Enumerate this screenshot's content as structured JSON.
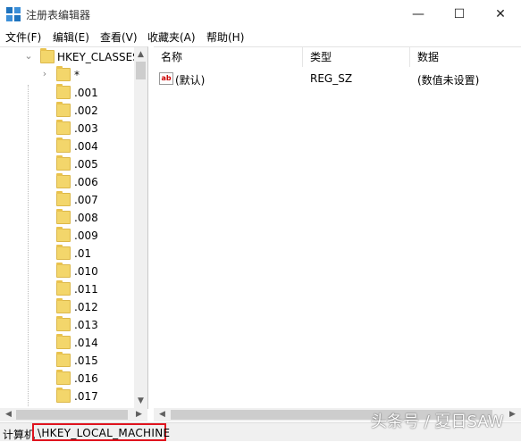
{
  "window": {
    "title": "注册表编辑器",
    "minimize": "—",
    "maximize": "☐",
    "close": "✕"
  },
  "menu": {
    "items": [
      "文件(F)",
      "编辑(E)",
      "查看(V)",
      "收藏夹(A)",
      "帮助(H)"
    ]
  },
  "tree": {
    "root_label": "HKEY_CLASSES",
    "root_chevron": "expanded",
    "items": [
      ".001",
      ".002",
      ".003",
      ".004",
      ".005",
      ".006",
      ".007",
      ".008",
      ".009",
      ".01",
      ".010",
      ".011",
      ".012",
      ".013",
      ".014",
      ".015",
      ".016",
      ".017"
    ],
    "first_item": "*"
  },
  "values": {
    "columns": [
      "名称",
      "类型",
      "数据"
    ],
    "rows": [
      {
        "name": "(默认)",
        "type": "REG_SZ",
        "data": "(数值未设置)",
        "icon": "ab"
      }
    ]
  },
  "status": {
    "prefix": "计算机",
    "path": "\\HKEY_LOCAL_MACHINE",
    "highlight_color": "#e0141e"
  },
  "watermark": "头条号 / 夏日SAW"
}
